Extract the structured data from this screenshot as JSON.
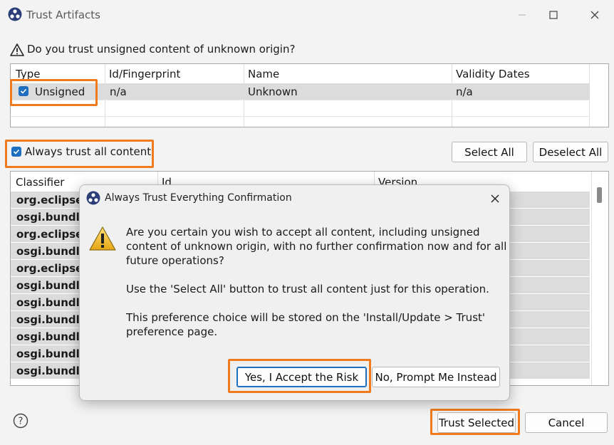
{
  "window": {
    "title": "Trust Artifacts",
    "question": "Do you trust unsigned content of unknown origin?"
  },
  "signers_table": {
    "headers": [
      "Type",
      "Id/Fingerprint",
      "Name",
      "Validity Dates"
    ],
    "rows": [
      {
        "type": "Unsigned",
        "checked": true,
        "id": "n/a",
        "name": "Unknown",
        "validity": "n/a"
      }
    ]
  },
  "always_trust": {
    "label": "Always trust all content",
    "checked": true
  },
  "buttons": {
    "select_all": "Select All",
    "deselect_all": "Deselect All",
    "trust_selected": "Trust Selected",
    "cancel": "Cancel"
  },
  "artifacts_table": {
    "headers": [
      "Classifier",
      "Id",
      "Version"
    ],
    "rows": [
      "org.eclipse.u",
      "osgi.bundle",
      "org.eclipse.u",
      "osgi.bundle",
      "org.eclipse.u",
      "osgi.bundle",
      "osgi.bundle",
      "osgi.bundle",
      "osgi.bundle",
      "osgi.bundle",
      "osgi.bundle"
    ]
  },
  "dialog": {
    "title": "Always Trust Everything Confirmation",
    "message_lines": [
      "Are you certain you wish to accept all content, including unsigned",
      "content of unknown origin, with no further confirmation now and for all",
      "future operations?",
      "Use the 'Select All' button to trust all content just for this operation.",
      "This preference choice will be stored on the 'Install/Update > Trust'",
      "preference page."
    ],
    "accept_button": "Yes, I Accept the Risk",
    "prompt_button": "No, Prompt Me Instead"
  },
  "colors": {
    "highlight": "#f07b1e",
    "checkbox": "#1f6fc1",
    "selected_row": "#dcdcdc"
  }
}
